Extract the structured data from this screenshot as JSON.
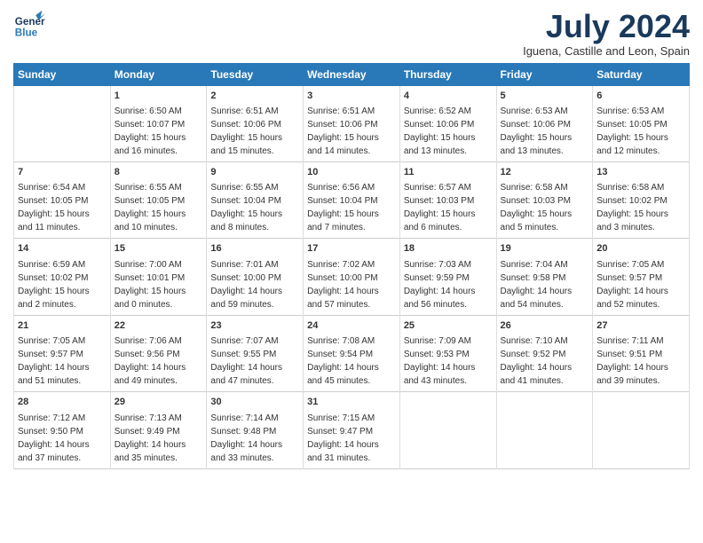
{
  "header": {
    "logo": {
      "general": "General",
      "blue": "Blue"
    },
    "title": "July 2024",
    "location": "Iguena, Castille and Leon, Spain"
  },
  "days_header": [
    "Sunday",
    "Monday",
    "Tuesday",
    "Wednesday",
    "Thursday",
    "Friday",
    "Saturday"
  ],
  "weeks": [
    [
      {
        "num": "",
        "sunrise": "",
        "sunset": "",
        "daylight": ""
      },
      {
        "num": "1",
        "sunrise": "Sunrise: 6:50 AM",
        "sunset": "Sunset: 10:07 PM",
        "daylight": "Daylight: 15 hours and 16 minutes."
      },
      {
        "num": "2",
        "sunrise": "Sunrise: 6:51 AM",
        "sunset": "Sunset: 10:06 PM",
        "daylight": "Daylight: 15 hours and 15 minutes."
      },
      {
        "num": "3",
        "sunrise": "Sunrise: 6:51 AM",
        "sunset": "Sunset: 10:06 PM",
        "daylight": "Daylight: 15 hours and 14 minutes."
      },
      {
        "num": "4",
        "sunrise": "Sunrise: 6:52 AM",
        "sunset": "Sunset: 10:06 PM",
        "daylight": "Daylight: 15 hours and 13 minutes."
      },
      {
        "num": "5",
        "sunrise": "Sunrise: 6:53 AM",
        "sunset": "Sunset: 10:06 PM",
        "daylight": "Daylight: 15 hours and 13 minutes."
      },
      {
        "num": "6",
        "sunrise": "Sunrise: 6:53 AM",
        "sunset": "Sunset: 10:05 PM",
        "daylight": "Daylight: 15 hours and 12 minutes."
      }
    ],
    [
      {
        "num": "7",
        "sunrise": "Sunrise: 6:54 AM",
        "sunset": "Sunset: 10:05 PM",
        "daylight": "Daylight: 15 hours and 11 minutes."
      },
      {
        "num": "8",
        "sunrise": "Sunrise: 6:55 AM",
        "sunset": "Sunset: 10:05 PM",
        "daylight": "Daylight: 15 hours and 10 minutes."
      },
      {
        "num": "9",
        "sunrise": "Sunrise: 6:55 AM",
        "sunset": "Sunset: 10:04 PM",
        "daylight": "Daylight: 15 hours and 8 minutes."
      },
      {
        "num": "10",
        "sunrise": "Sunrise: 6:56 AM",
        "sunset": "Sunset: 10:04 PM",
        "daylight": "Daylight: 15 hours and 7 minutes."
      },
      {
        "num": "11",
        "sunrise": "Sunrise: 6:57 AM",
        "sunset": "Sunset: 10:03 PM",
        "daylight": "Daylight: 15 hours and 6 minutes."
      },
      {
        "num": "12",
        "sunrise": "Sunrise: 6:58 AM",
        "sunset": "Sunset: 10:03 PM",
        "daylight": "Daylight: 15 hours and 5 minutes."
      },
      {
        "num": "13",
        "sunrise": "Sunrise: 6:58 AM",
        "sunset": "Sunset: 10:02 PM",
        "daylight": "Daylight: 15 hours and 3 minutes."
      }
    ],
    [
      {
        "num": "14",
        "sunrise": "Sunrise: 6:59 AM",
        "sunset": "Sunset: 10:02 PM",
        "daylight": "Daylight: 15 hours and 2 minutes."
      },
      {
        "num": "15",
        "sunrise": "Sunrise: 7:00 AM",
        "sunset": "Sunset: 10:01 PM",
        "daylight": "Daylight: 15 hours and 0 minutes."
      },
      {
        "num": "16",
        "sunrise": "Sunrise: 7:01 AM",
        "sunset": "Sunset: 10:00 PM",
        "daylight": "Daylight: 14 hours and 59 minutes."
      },
      {
        "num": "17",
        "sunrise": "Sunrise: 7:02 AM",
        "sunset": "Sunset: 10:00 PM",
        "daylight": "Daylight: 14 hours and 57 minutes."
      },
      {
        "num": "18",
        "sunrise": "Sunrise: 7:03 AM",
        "sunset": "Sunset: 9:59 PM",
        "daylight": "Daylight: 14 hours and 56 minutes."
      },
      {
        "num": "19",
        "sunrise": "Sunrise: 7:04 AM",
        "sunset": "Sunset: 9:58 PM",
        "daylight": "Daylight: 14 hours and 54 minutes."
      },
      {
        "num": "20",
        "sunrise": "Sunrise: 7:05 AM",
        "sunset": "Sunset: 9:57 PM",
        "daylight": "Daylight: 14 hours and 52 minutes."
      }
    ],
    [
      {
        "num": "21",
        "sunrise": "Sunrise: 7:05 AM",
        "sunset": "Sunset: 9:57 PM",
        "daylight": "Daylight: 14 hours and 51 minutes."
      },
      {
        "num": "22",
        "sunrise": "Sunrise: 7:06 AM",
        "sunset": "Sunset: 9:56 PM",
        "daylight": "Daylight: 14 hours and 49 minutes."
      },
      {
        "num": "23",
        "sunrise": "Sunrise: 7:07 AM",
        "sunset": "Sunset: 9:55 PM",
        "daylight": "Daylight: 14 hours and 47 minutes."
      },
      {
        "num": "24",
        "sunrise": "Sunrise: 7:08 AM",
        "sunset": "Sunset: 9:54 PM",
        "daylight": "Daylight: 14 hours and 45 minutes."
      },
      {
        "num": "25",
        "sunrise": "Sunrise: 7:09 AM",
        "sunset": "Sunset: 9:53 PM",
        "daylight": "Daylight: 14 hours and 43 minutes."
      },
      {
        "num": "26",
        "sunrise": "Sunrise: 7:10 AM",
        "sunset": "Sunset: 9:52 PM",
        "daylight": "Daylight: 14 hours and 41 minutes."
      },
      {
        "num": "27",
        "sunrise": "Sunrise: 7:11 AM",
        "sunset": "Sunset: 9:51 PM",
        "daylight": "Daylight: 14 hours and 39 minutes."
      }
    ],
    [
      {
        "num": "28",
        "sunrise": "Sunrise: 7:12 AM",
        "sunset": "Sunset: 9:50 PM",
        "daylight": "Daylight: 14 hours and 37 minutes."
      },
      {
        "num": "29",
        "sunrise": "Sunrise: 7:13 AM",
        "sunset": "Sunset: 9:49 PM",
        "daylight": "Daylight: 14 hours and 35 minutes."
      },
      {
        "num": "30",
        "sunrise": "Sunrise: 7:14 AM",
        "sunset": "Sunset: 9:48 PM",
        "daylight": "Daylight: 14 hours and 33 minutes."
      },
      {
        "num": "31",
        "sunrise": "Sunrise: 7:15 AM",
        "sunset": "Sunset: 9:47 PM",
        "daylight": "Daylight: 14 hours and 31 minutes."
      },
      {
        "num": "",
        "sunrise": "",
        "sunset": "",
        "daylight": ""
      },
      {
        "num": "",
        "sunrise": "",
        "sunset": "",
        "daylight": ""
      },
      {
        "num": "",
        "sunrise": "",
        "sunset": "",
        "daylight": ""
      }
    ]
  ]
}
